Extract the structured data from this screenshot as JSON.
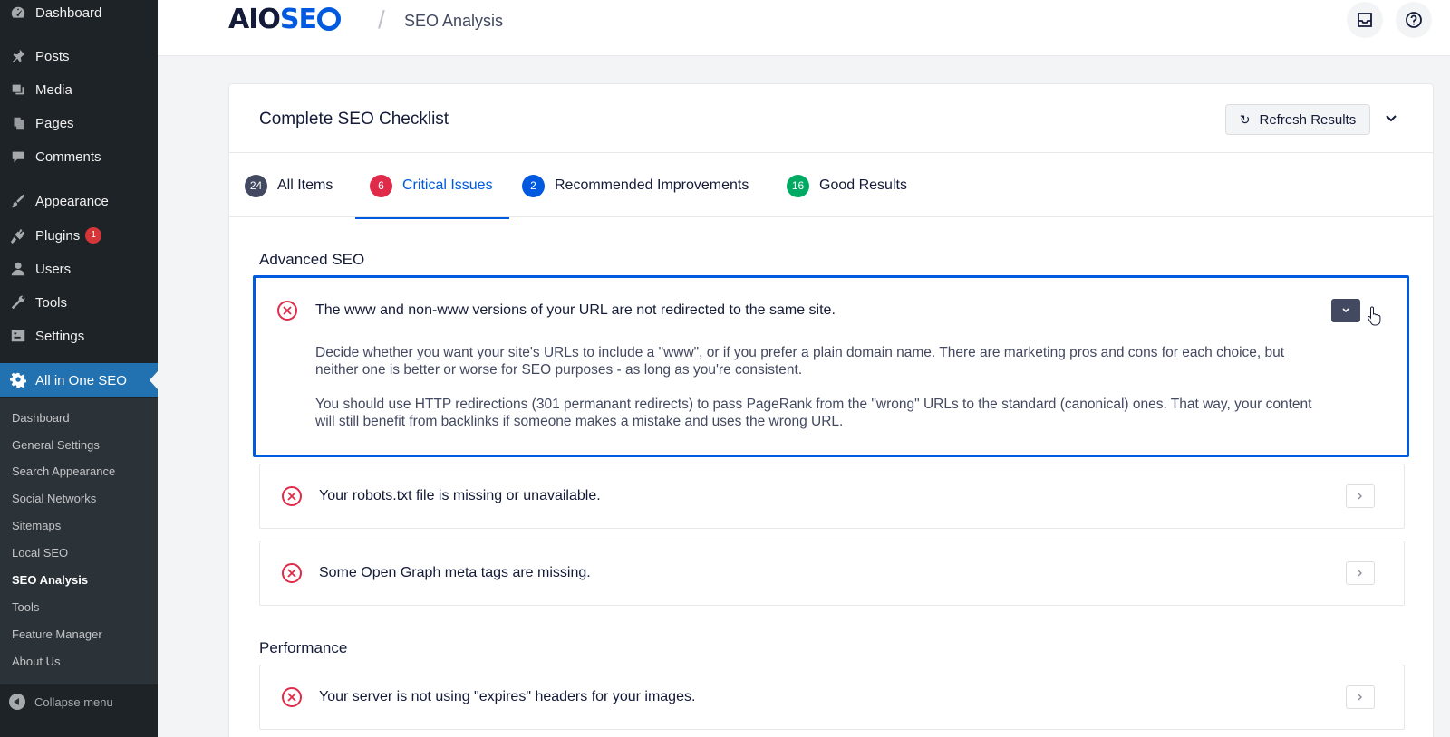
{
  "wp_menu": {
    "items": [
      {
        "label": "Dashboard",
        "icon": "dashboard-icon"
      },
      {
        "label": "Posts",
        "icon": "pin-icon"
      },
      {
        "label": "Media",
        "icon": "media-icon"
      },
      {
        "label": "Pages",
        "icon": "pages-icon"
      },
      {
        "label": "Comments",
        "icon": "comment-icon"
      },
      {
        "label": "Appearance",
        "icon": "brush-icon"
      },
      {
        "label": "Plugins",
        "icon": "plugin-icon",
        "badge": "1"
      },
      {
        "label": "Users",
        "icon": "user-icon"
      },
      {
        "label": "Tools",
        "icon": "wrench-icon"
      },
      {
        "label": "Settings",
        "icon": "settings-icon"
      },
      {
        "label": "All in One SEO",
        "icon": "gear-icon"
      }
    ],
    "submenu": [
      "Dashboard",
      "General Settings",
      "Search Appearance",
      "Social Networks",
      "Sitemaps",
      "Local SEO",
      "SEO Analysis",
      "Tools",
      "Feature Manager",
      "About Us"
    ],
    "current_sub": "SEO Analysis",
    "collapse_label": "Collapse menu"
  },
  "header": {
    "logo_aio": "AIO",
    "logo_seo": "SE",
    "separator": "/",
    "title": "SEO Analysis"
  },
  "card": {
    "title": "Complete SEO Checklist",
    "refresh_label": "Refresh Results",
    "tabs": [
      {
        "count": "24",
        "label": "All Items",
        "color": "#434960"
      },
      {
        "count": "6",
        "label": "Critical Issues",
        "color": "#df2a4a"
      },
      {
        "count": "2",
        "label": "Recommended Improvements",
        "color": "#005ae0"
      },
      {
        "count": "16",
        "label": "Good Results",
        "color": "#00aa63"
      }
    ],
    "sections": [
      {
        "title": "Advanced SEO",
        "items": [
          {
            "title": "The www and non-www versions of your URL are not redirected to the same site.",
            "desc1": "Decide whether you want your site's URLs to include a \"www\", or if you prefer a plain domain name. There are marketing pros and cons for each choice, but neither one is better or worse for SEO purposes - as long as you're consistent.",
            "desc2": "You should use HTTP redirections (301 permanant redirects) to pass PageRank from the \"wrong\" URLs to the standard (canonical) ones. That way, your content will still benefit from backlinks if someone makes a mistake and uses the wrong URL."
          },
          {
            "title": "Your robots.txt file is missing or unavailable."
          },
          {
            "title": "Some Open Graph meta tags are missing."
          }
        ]
      },
      {
        "title": "Performance",
        "items": [
          {
            "title": "Your server is not using \"expires\" headers for your images."
          }
        ]
      }
    ]
  }
}
